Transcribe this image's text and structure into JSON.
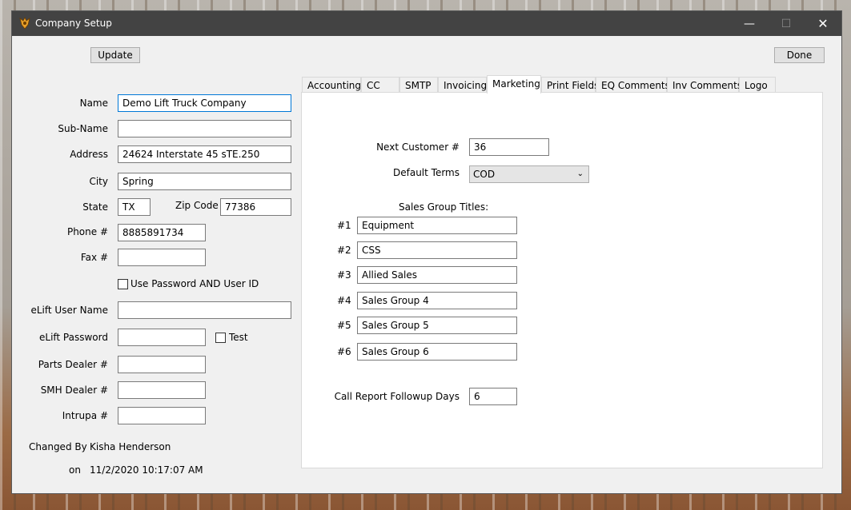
{
  "window": {
    "title": "Company Setup",
    "minimize_glyph": "—",
    "maximize_glyph": "☐",
    "close_glyph": "✕"
  },
  "toolbar": {
    "update_label": "Update",
    "done_label": "Done"
  },
  "company": {
    "name_label": "Name",
    "name_value": "Demo Lift Truck Company",
    "subname_label": "Sub-Name",
    "subname_value": "",
    "address_label": "Address",
    "address_value": "24624 Interstate 45 sTE.250",
    "city_label": "City",
    "city_value": "Spring",
    "state_label": "State",
    "state_value": "TX",
    "zip_label": "Zip Code",
    "zip_value": "77386",
    "phone_label": "Phone #",
    "phone_value": "8885891734",
    "fax_label": "Fax #",
    "fax_value": "",
    "use_password_label": "Use Password AND User ID",
    "elift_user_label": "eLift User Name",
    "elift_user_value": "",
    "elift_password_label": "eLift Password",
    "elift_password_value": "",
    "test_label": "Test",
    "parts_dealer_label": "Parts Dealer #",
    "parts_dealer_value": "",
    "smh_dealer_label": "SMH Dealer #",
    "smh_dealer_value": "",
    "intrupa_label": "Intrupa #",
    "intrupa_value": "",
    "changed_by_label": "Changed By",
    "changed_by_value": "Kisha Henderson",
    "on_label": "on",
    "on_value": "11/2/2020 10:17:07 AM"
  },
  "tabs": [
    {
      "label": "Accounting"
    },
    {
      "label": "CC"
    },
    {
      "label": "SMTP"
    },
    {
      "label": "Invoicing"
    },
    {
      "label": "Marketing"
    },
    {
      "label": "Print Fields"
    },
    {
      "label": "EQ Comments"
    },
    {
      "label": "Inv Comments"
    },
    {
      "label": "Logo"
    }
  ],
  "active_tab": "Marketing",
  "marketing": {
    "next_customer_label": "Next Customer #",
    "next_customer_value": "36",
    "default_terms_label": "Default Terms",
    "default_terms_value": "COD",
    "sales_group_titles_label": "Sales Group Titles:",
    "groups": [
      {
        "num": "#1",
        "value": "Equipment"
      },
      {
        "num": "#2",
        "value": "CSS"
      },
      {
        "num": "#3",
        "value": "Allied Sales"
      },
      {
        "num": "#4",
        "value": "Sales Group 4"
      },
      {
        "num": "#5",
        "value": "Sales Group 5"
      },
      {
        "num": "#6",
        "value": "Sales Group 6"
      }
    ],
    "followup_label": "Call Report Followup Days",
    "followup_value": "6"
  },
  "colors": {
    "titlebar": "#434343",
    "focus": "#0078d7",
    "panel": "#ffffff",
    "window": "#f0f0f0"
  }
}
